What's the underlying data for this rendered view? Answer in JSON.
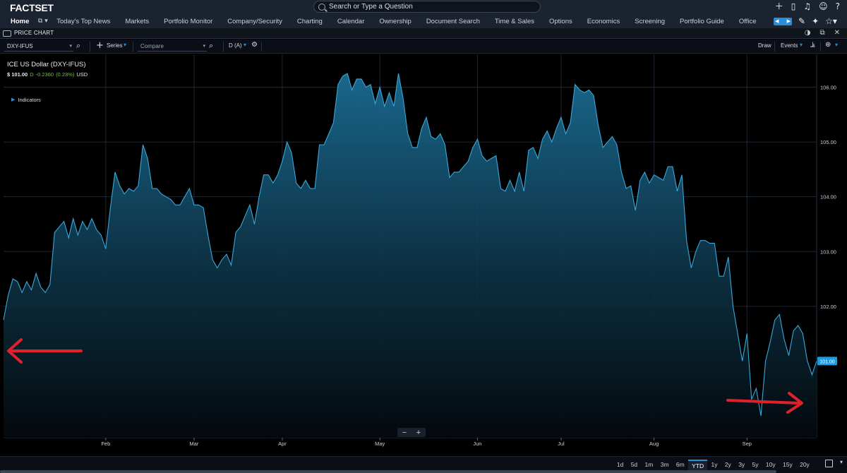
{
  "app": {
    "logo": "FACTSET",
    "search_placeholder": "Search or Type a Question"
  },
  "nav": {
    "home": "Home",
    "items": [
      "Today's Top News",
      "Markets",
      "Portfolio Monitor",
      "Company/Security",
      "Charting",
      "Calendar",
      "Ownership",
      "Document Search",
      "Time & Sales",
      "Options",
      "Economics",
      "Screening",
      "Portfolio Guide",
      "Office"
    ]
  },
  "panel": {
    "title": "PRICE CHART"
  },
  "toolbar": {
    "ticker": "DXY-IFUS",
    "series_label": "Series",
    "compare_placeholder": "Compare",
    "frequency": "D (A)",
    "draw_label": "Draw",
    "events_label": "Events"
  },
  "legend": {
    "title": "ICE US Dollar (DXY-IFUS)",
    "price": "$ 101.00",
    "change_prefix": "D",
    "change": "-0.2360",
    "change_pct": "(0.23%)",
    "currency": "USD",
    "indicators_label": "Indicators"
  },
  "zoom": {
    "minus": "−",
    "plus": "+"
  },
  "ranges": [
    "1d",
    "5d",
    "1m",
    "3m",
    "6m",
    "YTD",
    "1y",
    "2y",
    "3y",
    "5y",
    "10y",
    "15y",
    "20y"
  ],
  "active_range": "YTD",
  "colors": {
    "line": "#3aa7d8",
    "accent": "#2a8ed6",
    "annotation": "#e0202a",
    "last_price_bg": "#1e9be0"
  },
  "chart_data": {
    "type": "area",
    "y_tick_labels": [
      "102.00",
      "103.00",
      "104.00",
      "105.00",
      "106.00"
    ],
    "ylim": [
      99.6,
      106.6
    ],
    "x_tick_labels": [
      "Feb",
      "Mar",
      "Apr",
      "May",
      "Jun",
      "Jul",
      "Aug",
      "Sep"
    ],
    "x_tick_index": [
      22,
      41,
      60,
      81,
      102,
      120,
      140,
      160
    ],
    "last_price_label": "101.00",
    "series": [
      {
        "values": [
          101.75,
          102.2,
          102.5,
          102.45,
          102.25,
          102.45,
          102.3,
          102.6,
          102.35,
          102.25,
          102.4,
          103.35,
          103.45,
          103.55,
          103.25,
          103.6,
          103.3,
          103.55,
          103.4,
          103.6,
          103.4,
          103.3,
          103.05,
          103.8,
          104.45,
          104.2,
          104.05,
          104.15,
          104.1,
          104.2,
          104.95,
          104.7,
          104.15,
          104.15,
          104.05,
          104.0,
          103.95,
          103.85,
          103.85,
          104.0,
          104.15,
          103.85,
          103.85,
          103.8,
          103.3,
          102.85,
          102.7,
          102.85,
          102.95,
          102.75,
          103.35,
          103.45,
          103.65,
          103.85,
          103.5,
          104.0,
          104.4,
          104.4,
          104.25,
          104.4,
          104.65,
          105.0,
          104.8,
          104.25,
          104.15,
          104.3,
          104.15,
          104.15,
          104.95,
          104.95,
          105.15,
          105.35,
          106.05,
          106.2,
          106.25,
          105.95,
          106.15,
          106.15,
          106.0,
          106.05,
          105.7,
          106.0,
          105.65,
          105.9,
          105.65,
          106.25,
          105.8,
          105.15,
          104.9,
          104.9,
          105.25,
          105.45,
          105.1,
          105.05,
          105.15,
          104.95,
          104.35,
          104.45,
          104.45,
          104.55,
          104.65,
          104.9,
          105.05,
          104.75,
          104.65,
          104.7,
          104.75,
          104.15,
          104.1,
          104.3,
          104.1,
          104.45,
          104.1,
          104.85,
          104.9,
          104.7,
          105.05,
          105.2,
          105.0,
          105.25,
          105.45,
          105.15,
          105.35,
          106.05,
          105.95,
          105.9,
          105.95,
          105.85,
          105.3,
          104.9,
          105.0,
          105.1,
          104.95,
          104.45,
          104.15,
          104.2,
          103.75,
          104.3,
          104.45,
          104.25,
          104.4,
          104.35,
          104.3,
          104.55,
          104.55,
          104.1,
          104.4,
          103.2,
          102.7,
          103.0,
          103.2,
          103.2,
          103.15,
          103.15,
          102.55,
          102.55,
          102.9,
          102.0,
          101.5,
          101.0,
          101.5,
          100.3,
          100.5,
          100.0,
          101.0,
          101.35,
          101.75,
          101.85,
          101.4,
          101.1,
          101.55,
          101.65,
          101.5,
          101.0,
          100.75,
          101.0
        ]
      }
    ],
    "grid": true
  }
}
